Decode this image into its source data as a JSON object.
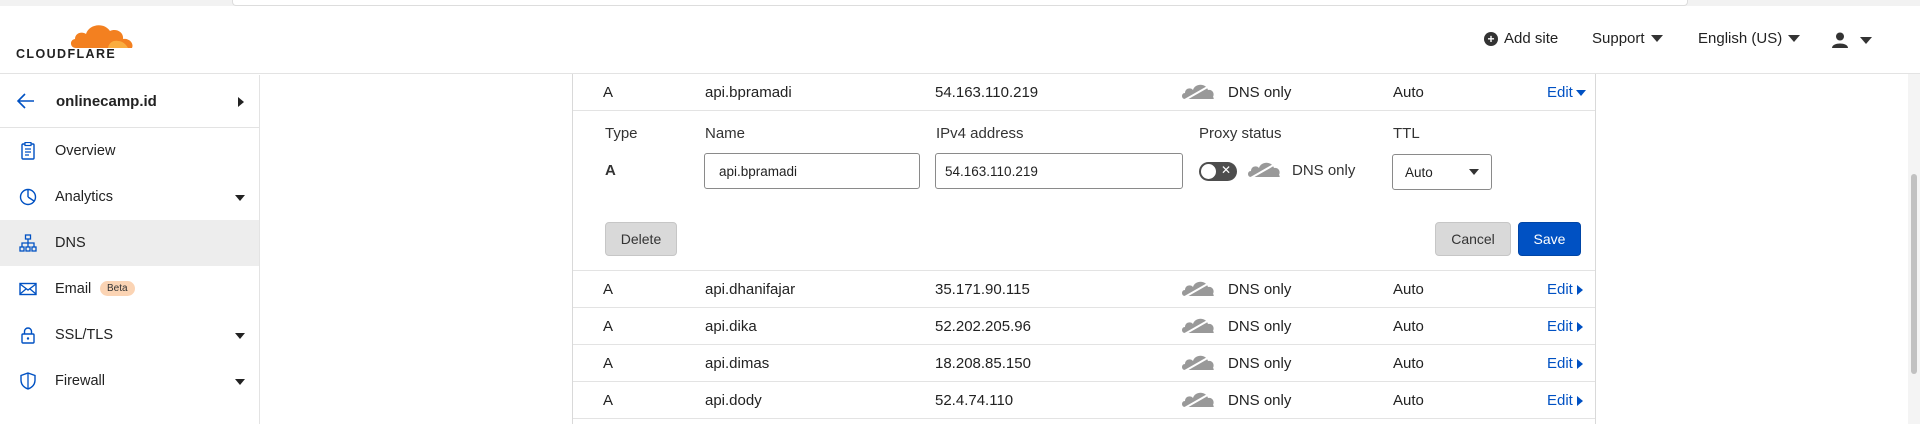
{
  "header": {
    "logo_text": "CLOUDFLARE",
    "add_site": "Add site",
    "support": "Support",
    "language": "English (US)"
  },
  "sidebar": {
    "zone": "onlinecamp.id",
    "items": [
      {
        "label": "Overview"
      },
      {
        "label": "Analytics"
      },
      {
        "label": "DNS"
      },
      {
        "label": "Email",
        "badge": "Beta"
      },
      {
        "label": "SSL/TLS"
      },
      {
        "label": "Firewall"
      }
    ]
  },
  "editing_record": {
    "type": "A",
    "name": "api.bpramadi",
    "content": "54.163.110.219",
    "proxy": "DNS only",
    "ttl": "Auto",
    "edit": "Edit"
  },
  "form": {
    "label_type": "Type",
    "label_name": "Name",
    "label_ip": "IPv4 address",
    "label_proxy": "Proxy status",
    "label_ttl": "TTL",
    "type_value": "A",
    "name_value": "api.bpramadi",
    "ip_value": "54.163.110.219",
    "proxy_value": "DNS only",
    "ttl_value": "Auto",
    "delete": "Delete",
    "cancel": "Cancel",
    "save": "Save"
  },
  "records": [
    {
      "type": "A",
      "name": "api.dhanifajar",
      "content": "35.171.90.115",
      "proxy": "DNS only",
      "ttl": "Auto",
      "edit": "Edit"
    },
    {
      "type": "A",
      "name": "api.dika",
      "content": "52.202.205.96",
      "proxy": "DNS only",
      "ttl": "Auto",
      "edit": "Edit"
    },
    {
      "type": "A",
      "name": "api.dimas",
      "content": "18.208.85.150",
      "proxy": "DNS only",
      "ttl": "Auto",
      "edit": "Edit"
    },
    {
      "type": "A",
      "name": "api.dody",
      "content": "52.4.74.110",
      "proxy": "DNS only",
      "ttl": "Auto",
      "edit": "Edit"
    }
  ],
  "colors": {
    "accent": "#0051c3",
    "brand_orange": "#f38020"
  }
}
